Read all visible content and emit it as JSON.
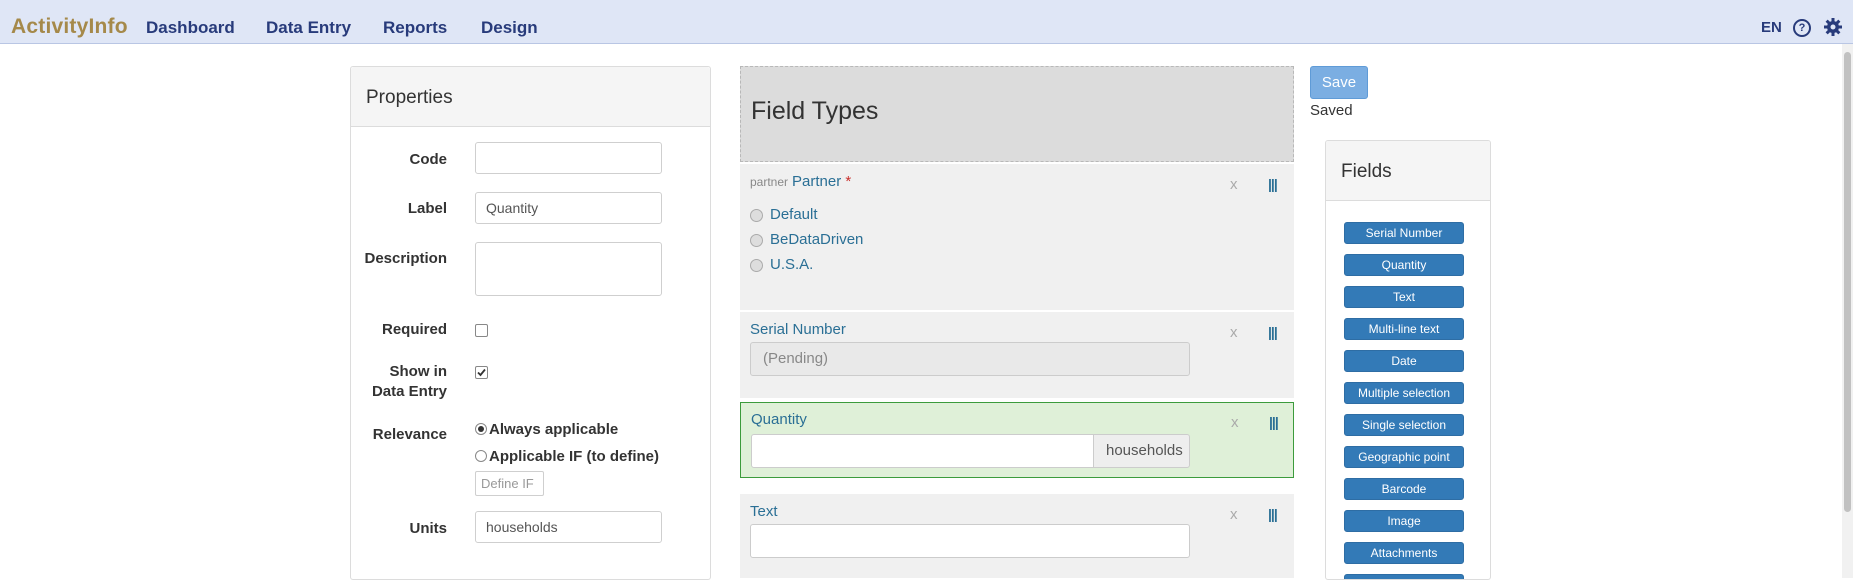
{
  "nav": {
    "brand": "ActivityInfo",
    "links": [
      "Dashboard",
      "Data Entry",
      "Reports",
      "Design"
    ],
    "language": "EN"
  },
  "properties": {
    "title": "Properties",
    "code_label": "Code",
    "code_value": "",
    "label_label": "Label",
    "label_value": "Quantity",
    "description_label": "Description",
    "description_value": "",
    "required_label": "Required",
    "required_checked": false,
    "show_label_line1": "Show in",
    "show_label_line2": "Data Entry",
    "show_checked": true,
    "relevance_label": "Relevance",
    "relevance_options": [
      "Always applicable",
      "Applicable IF (to define)"
    ],
    "relevance_selected": "Always applicable",
    "define_if_label": "Define IF",
    "units_label": "Units",
    "units_value": "households"
  },
  "form": {
    "title": "Field Types",
    "fields": [
      {
        "code": "partner",
        "label": "Partner",
        "required_marker": "*",
        "remove_label": "x",
        "drag_label": "|||",
        "options": [
          "Default",
          "BeDataDriven",
          "U.S.A."
        ]
      },
      {
        "label": "Serial Number",
        "remove_label": "x",
        "drag_label": "|||",
        "value": "(Pending)"
      },
      {
        "label": "Quantity",
        "remove_label": "x",
        "drag_label": "|||",
        "value": "",
        "units": "households"
      },
      {
        "label": "Text",
        "remove_label": "x",
        "drag_label": "|||",
        "value": ""
      }
    ]
  },
  "save": {
    "label": "Save",
    "status": "Saved"
  },
  "palette": {
    "title": "Fields",
    "items": [
      "Serial Number",
      "Quantity",
      "Text",
      "Multi-line text",
      "Date",
      "Multiple selection",
      "Single selection",
      "Geographic point",
      "Barcode",
      "Image",
      "Attachments"
    ]
  },
  "colors": {
    "navbar_bg": "#dfe6f6",
    "brand": "#a5894a",
    "nav_text": "#283b7b",
    "field_label": "#2a6f95",
    "active_field_bg": "#dff0d8",
    "active_field_border": "#3c9b3c",
    "palette_button": "#337ab7",
    "save_button": "#7baee2"
  }
}
